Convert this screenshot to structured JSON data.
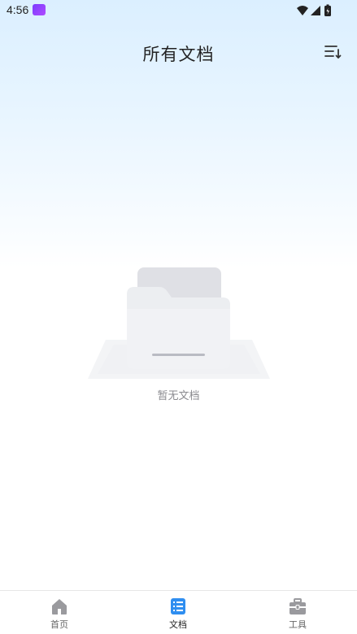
{
  "status_bar": {
    "time": "4:56",
    "icons": [
      "app-notification-icon",
      "wifi-icon",
      "signal-icon",
      "battery-icon"
    ]
  },
  "header": {
    "title": "所有文档",
    "sort_icon": "sort-icon"
  },
  "empty_state": {
    "illustration_icon": "empty-folder-icon",
    "message": "暂无文档"
  },
  "bottom_nav": {
    "items": [
      {
        "label": "首页",
        "icon": "home-icon",
        "active": false
      },
      {
        "label": "文档",
        "icon": "document-icon",
        "active": true
      },
      {
        "label": "工具",
        "icon": "toolbox-icon",
        "active": false
      }
    ]
  },
  "colors": {
    "accent": "#2f8ef0",
    "inactive_icon": "#9a9a9e",
    "title": "#222222",
    "empty_text": "#8a8a8f"
  }
}
